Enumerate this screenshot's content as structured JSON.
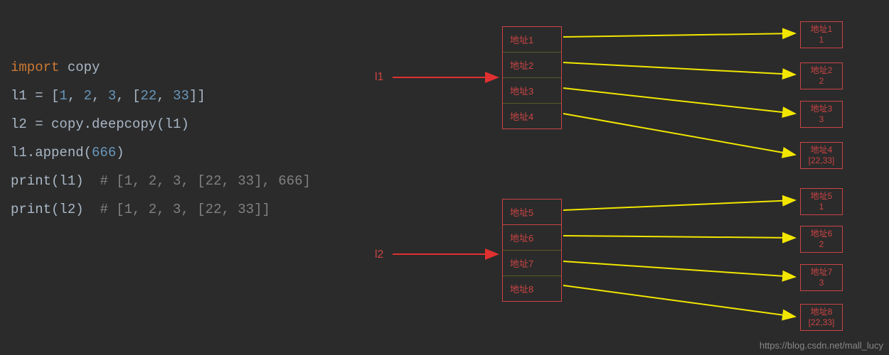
{
  "code": {
    "line1": {
      "import": "import",
      "module": "copy"
    },
    "line2": {
      "var": "l1",
      "eq": " = [",
      "n1": "1",
      "c1": ", ",
      "n2": "2",
      "c2": ", ",
      "n3": "3",
      "c3": ", [",
      "n4": "22",
      "c4": ", ",
      "n5": "33",
      "end": "]]"
    },
    "line3": {
      "var": "l2",
      "eq": " = copy.deepcopy(l1)"
    },
    "line4": {
      "var": "l1",
      "call": ".append(",
      "n": "666",
      "end": ")"
    },
    "line5": {
      "fn": "print",
      "open": "(l1)  ",
      "comment": "# [1, 2, 3, [22, 33], 666]"
    },
    "line6": {
      "fn": "print",
      "open": "(l2)  ",
      "comment": "# [1, 2, 3, [22, 33]]"
    }
  },
  "labels": {
    "l1": "l1",
    "l2": "l2"
  },
  "stack1": {
    "a1": "地址1",
    "a2": "地址2",
    "a3": "地址3",
    "a4": "地址4"
  },
  "stack2": {
    "a5": "地址5",
    "a6": "地址6",
    "a7": "地址7",
    "a8": "地址8"
  },
  "values": {
    "v1": {
      "label": "地址1",
      "val": "1"
    },
    "v2": {
      "label": "地址2",
      "val": "2"
    },
    "v3": {
      "label": "地址3",
      "val": "3"
    },
    "v4": {
      "label": "地址4",
      "val": "[22,33]"
    },
    "v5": {
      "label": "地址5",
      "val": "1"
    },
    "v6": {
      "label": "地址6",
      "val": "2"
    },
    "v7": {
      "label": "地址7",
      "val": "3"
    },
    "v8": {
      "label": "地址8",
      "val": "[22,33]"
    }
  },
  "watermark": "https://blog.csdn.net/mall_lucy"
}
